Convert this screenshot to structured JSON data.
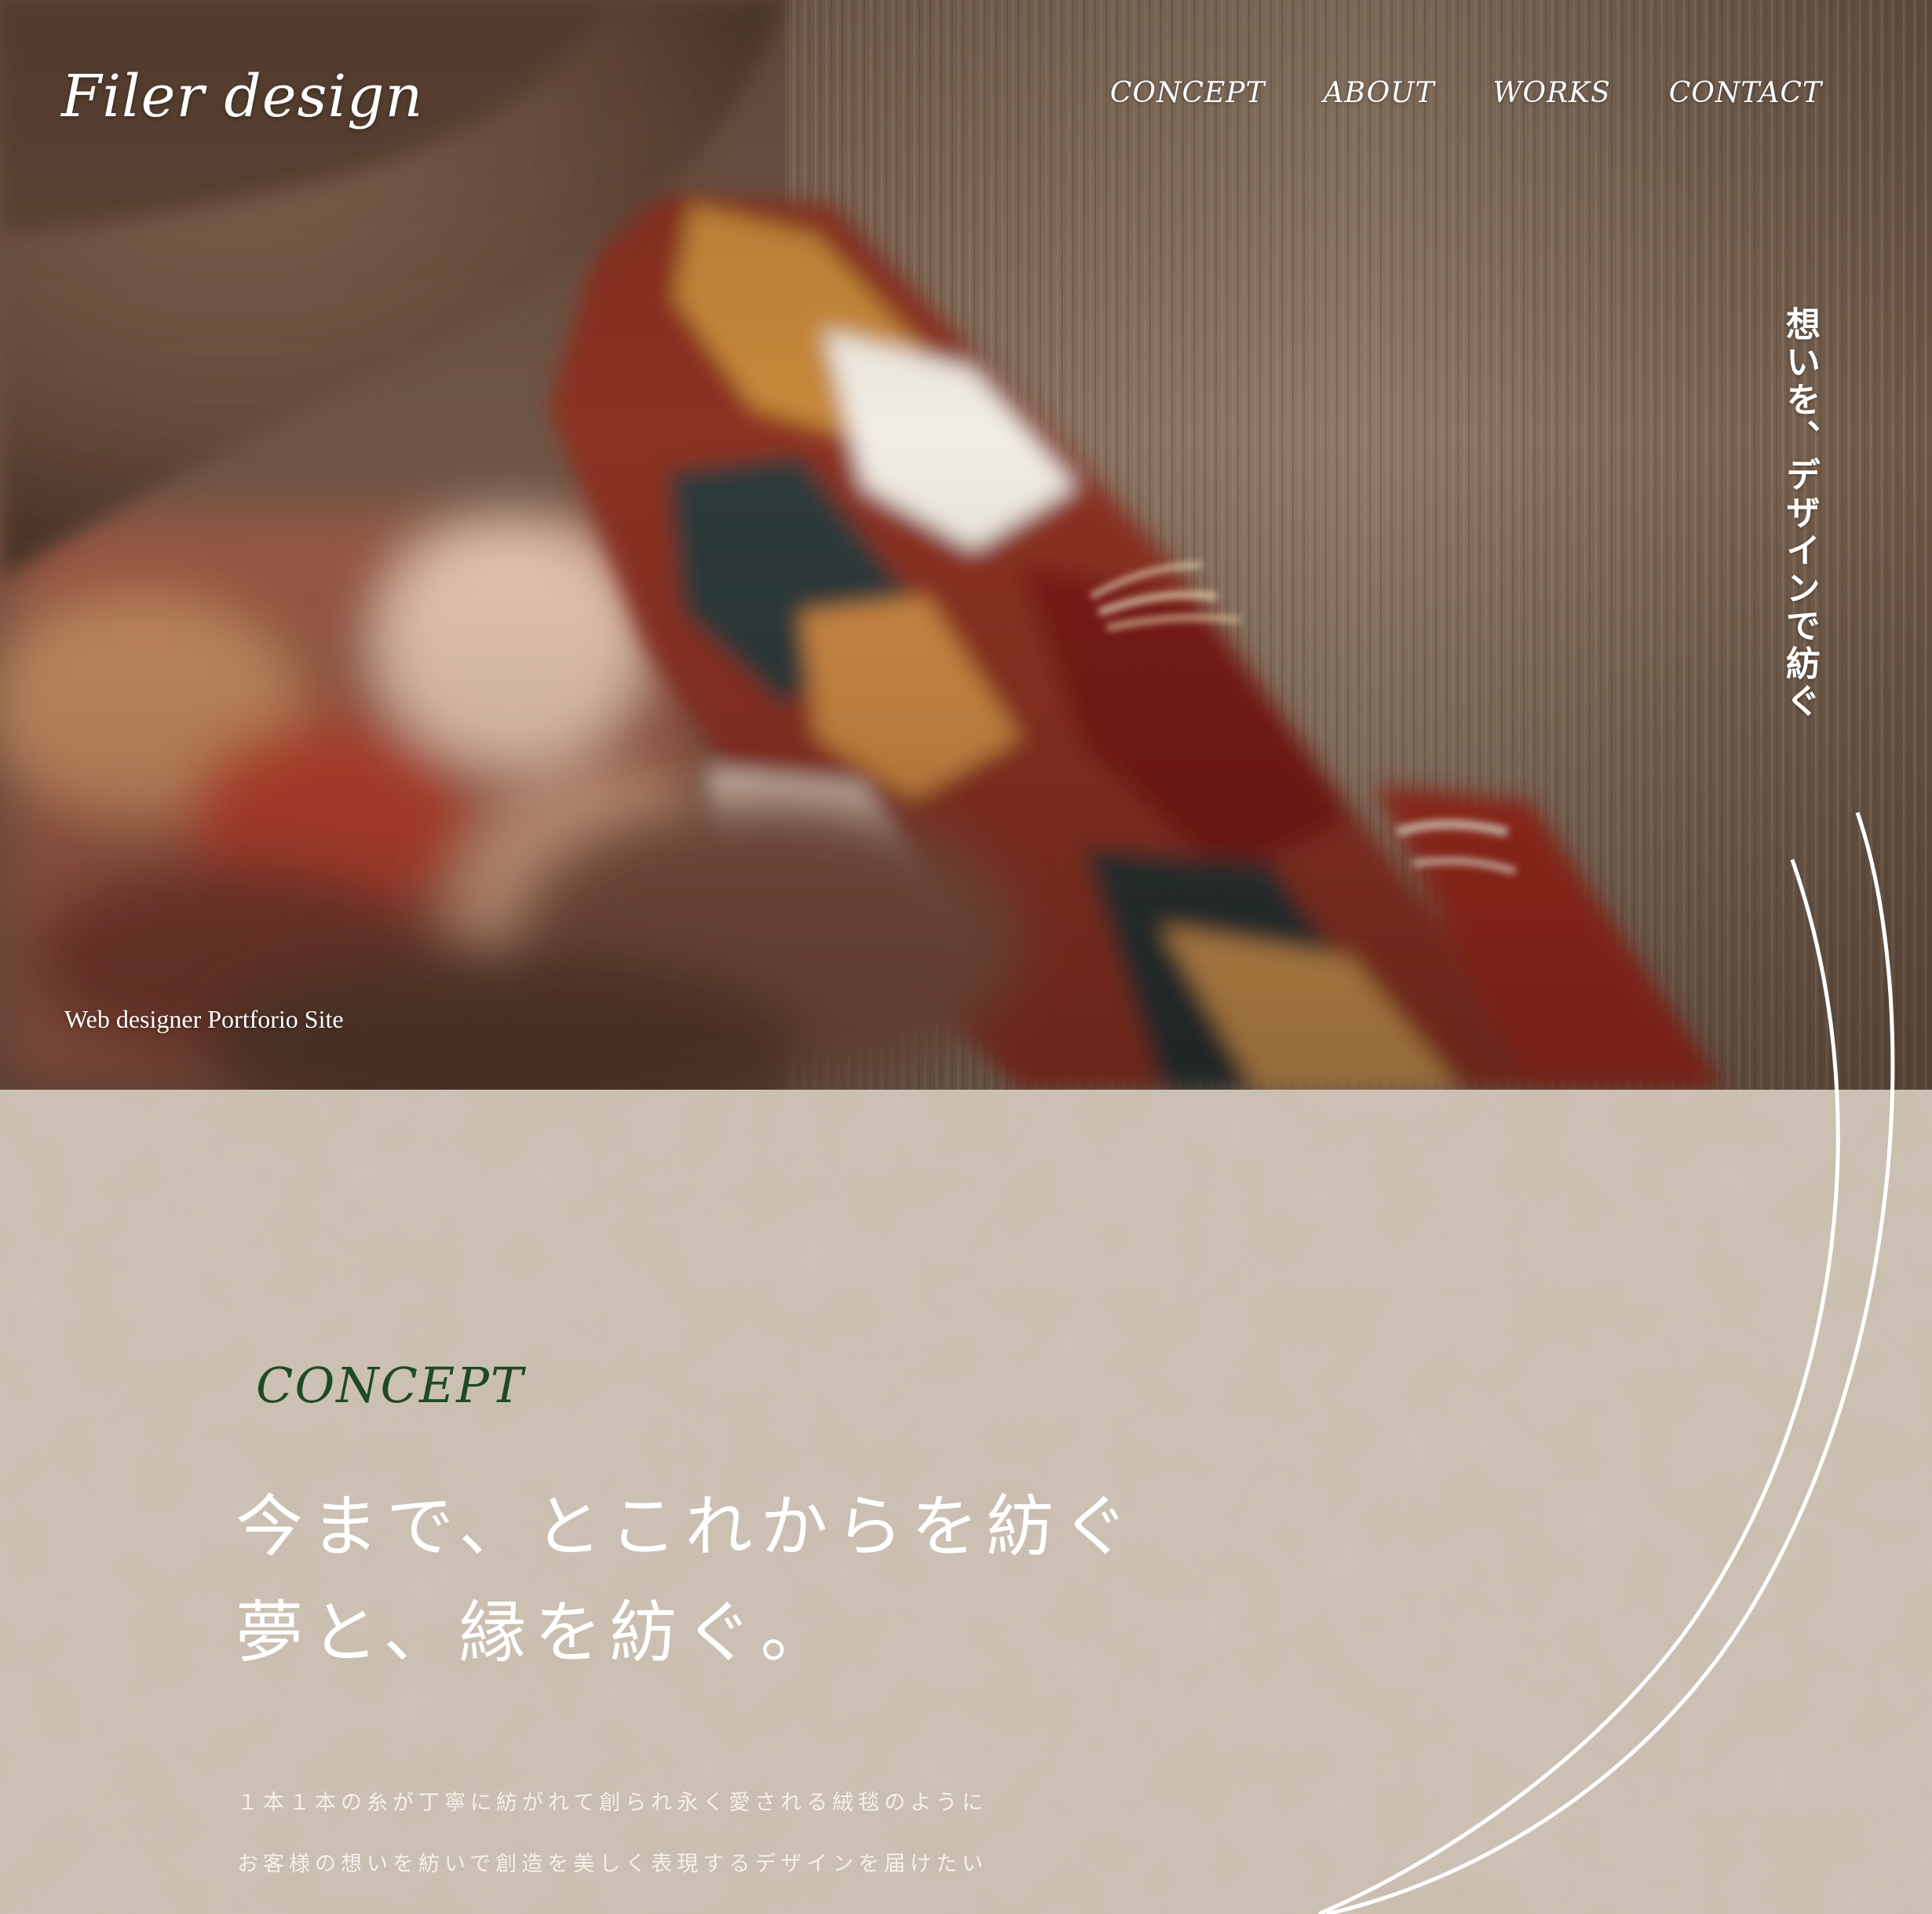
{
  "header": {
    "logo": "Filer design",
    "nav": [
      "CONCEPT",
      "ABOUT",
      "WORKS",
      "CONTACT"
    ]
  },
  "hero": {
    "tagline": "想いを、デザインで紡ぐ",
    "subtitle": "Web designer Portforio Site"
  },
  "concept": {
    "heading": "CONCEPT",
    "title_lines": [
      "今まで、とこれからを紡ぐ",
      "夢と、縁を紡ぐ。"
    ],
    "body_lines": [
      "１本１本の糸が丁寧に紡がれて創られ永く愛される絨毯のように",
      "お客様の想いを紡いで創造を美しく表現するデザインを届けたい"
    ]
  },
  "colors": {
    "heading_green": "#1e4a24",
    "paper": "#c8bcae",
    "text_white": "#ffffff"
  }
}
